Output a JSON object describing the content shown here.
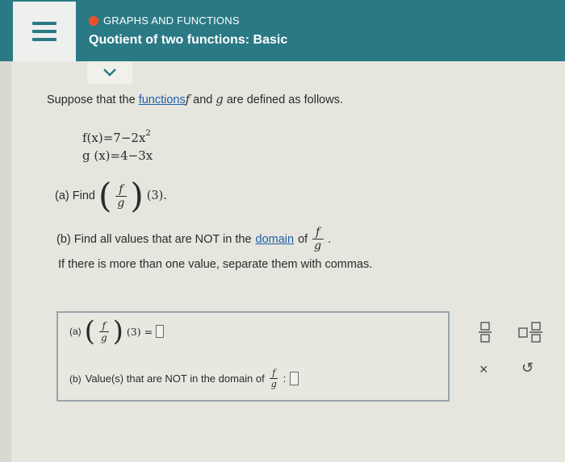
{
  "header": {
    "category": "GRAPHS AND FUNCTIONS",
    "title": "Quotient of two functions: Basic",
    "accent_color": "#2a7a86",
    "status_dot_color": "#e8542a"
  },
  "problem": {
    "intro_pre": "Suppose that the",
    "intro_link": "functions",
    "intro_f": "f",
    "intro_and": "and",
    "intro_g": "g",
    "intro_post": "are defined as follows.",
    "f_def": "f(x)=7−2x",
    "f_exp": "2",
    "g_def": "g (x)=4−3x",
    "part_a_label": "(a) Find",
    "frac_num": "f",
    "frac_den": "g",
    "part_a_arg": "(3).",
    "part_b_pre": "(b) Find all values that are NOT in the",
    "part_b_link": "domain",
    "part_b_of": "of",
    "part_b_end": ".",
    "note": "If there is more than one value, separate them with commas."
  },
  "answer": {
    "a_label": "(a)",
    "a_expr": "(3) =",
    "b_label": "(b)",
    "b_text": "Value(s) that are NOT in the domain of",
    "b_colon": ":"
  },
  "tools": {
    "clear_icon": "×",
    "undo_icon": "↺"
  }
}
